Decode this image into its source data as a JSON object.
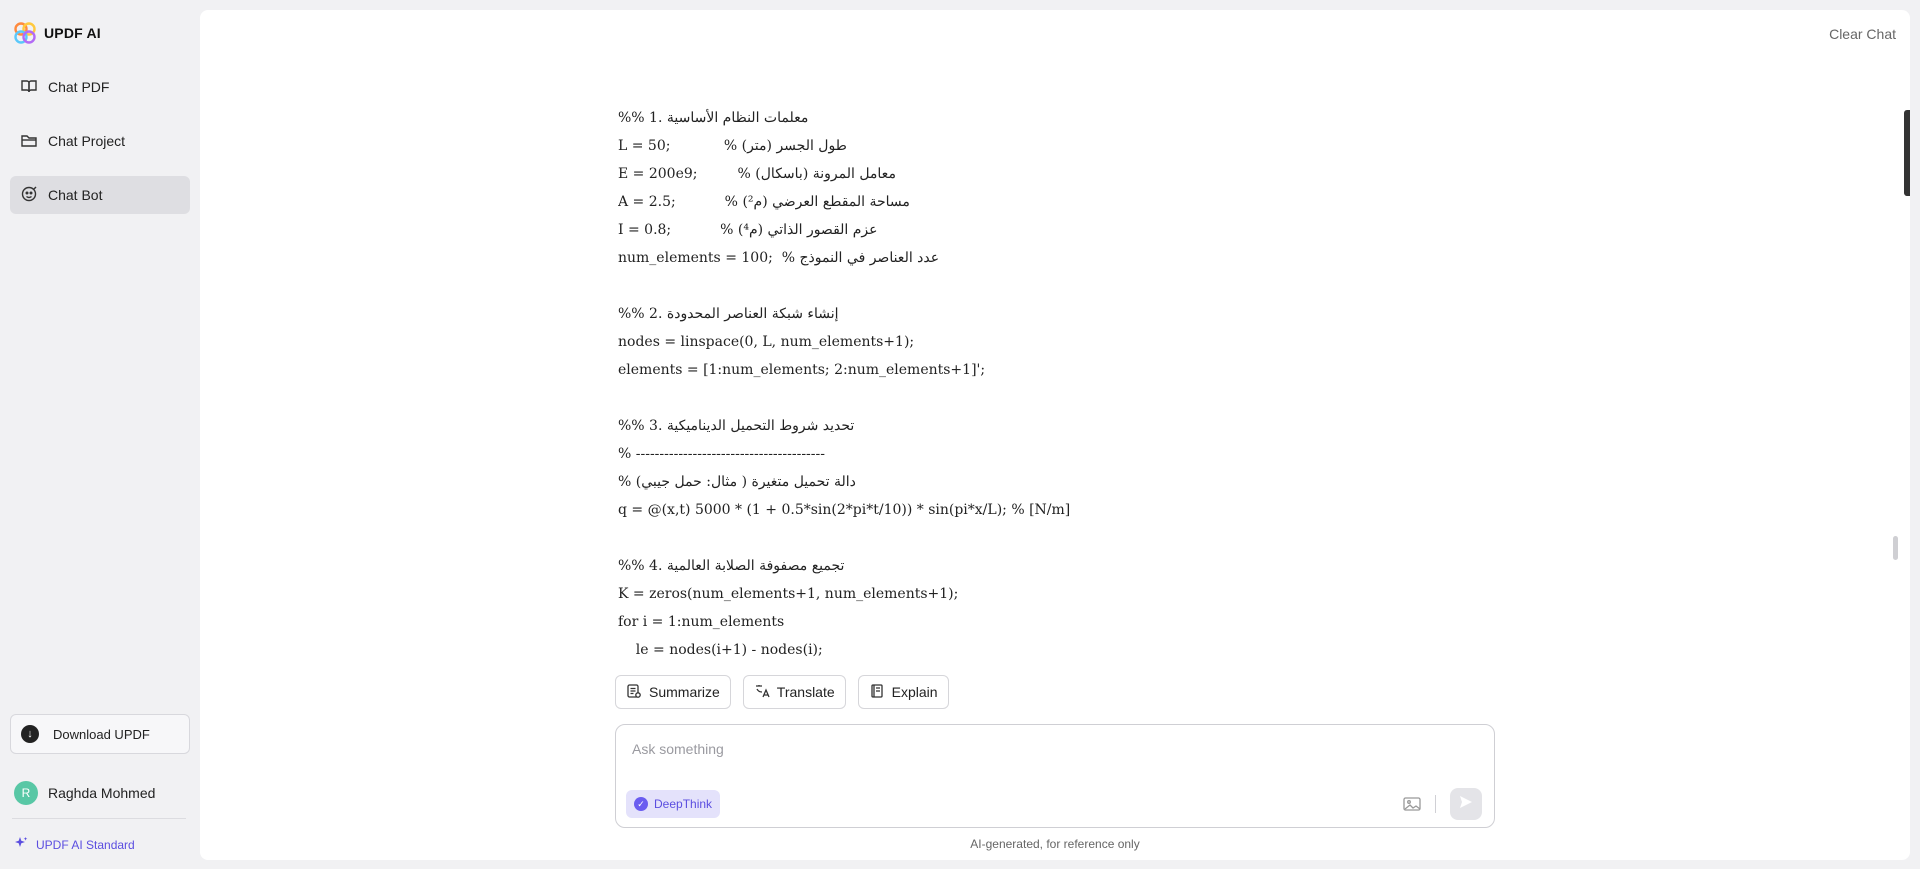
{
  "brand": {
    "name": "UPDF AI"
  },
  "sidebar": {
    "items": [
      {
        "label": "Chat PDF",
        "icon": "book-icon"
      },
      {
        "label": "Chat Project",
        "icon": "folder-icon"
      },
      {
        "label": "Chat Bot",
        "icon": "bot-icon",
        "active": true
      }
    ],
    "download_label": "Download UPDF",
    "user": {
      "initial": "R",
      "name": "Raghda Mohmed"
    },
    "plan_label": "UPDF AI Standard"
  },
  "header": {
    "clear_chat": "Clear Chat"
  },
  "code_lines": [
    "%% 1. معلمات النظام الأساسية",
    "L = 50;            % طول الجسر (متر)",
    "E = 200e9;         % معامل المرونة (باسكال)",
    "A = 2.5;           % مساحة المقطع العرضي (م²)",
    "I = 0.8;           % عزم القصور الذاتي (م⁴)",
    "num_elements = 100;  % عدد العناصر في النموذج",
    "",
    "%% 2. إنشاء شبكة العناصر المحدودة",
    "nodes = linspace(0, L, num_elements+1);",
    "elements = [1:num_elements; 2:num_elements+1]';",
    "",
    "%% 3. تحديد شروط التحميل الديناميكية",
    "% ----------------------------------------",
    "% دالة تحميل متغيرة ( مثال: حمل جيبي)",
    "q = @(x,t) 5000 * (1 + 0.5*sin(2*pi*t/10)) * sin(pi*x/L); % [N/m]",
    "",
    "%% 4. تجميع مصفوفة الصلابة العالمية",
    "K = zeros(num_elements+1, num_elements+1);",
    "for i = 1:num_elements",
    "    le = nodes(i+1) - nodes(i);"
  ],
  "actions": {
    "summarize": "Summarize",
    "translate": "Translate",
    "explain": "Explain"
  },
  "input": {
    "placeholder": "Ask something",
    "value": "",
    "deepthink_label": "DeepThink"
  },
  "disclaimer": "AI-generated, for reference only",
  "colors": {
    "accent": "#5b4ee0",
    "active_nav": "#dedee2",
    "background": "#f1f1f3"
  }
}
